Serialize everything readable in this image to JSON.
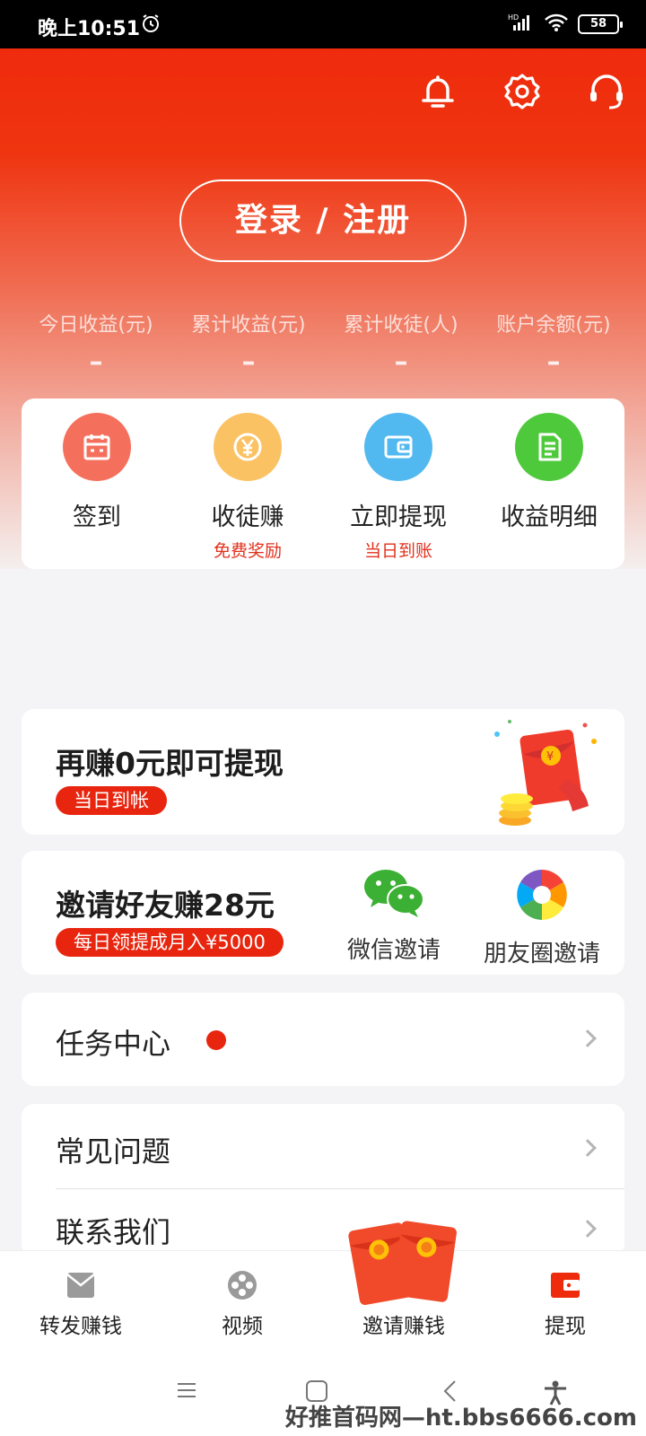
{
  "status_bar": {
    "time": "晚上10:51",
    "battery": "58",
    "network": "HD"
  },
  "header": {
    "login_button": "登录 / 注册",
    "stats": [
      {
        "label": "今日收益(元)",
        "value": "–"
      },
      {
        "label": "累计收益(元)",
        "value": "–"
      },
      {
        "label": "累计收徒(人)",
        "value": "–"
      },
      {
        "label": "账户余额(元)",
        "value": "–"
      }
    ]
  },
  "quick_actions": [
    {
      "label": "签到",
      "sub": "",
      "icon": "calendar-icon",
      "color": "#f5705c"
    },
    {
      "label": "收徒赚",
      "sub": "免费奖励",
      "icon": "yen-coin-icon",
      "color": "#fbc263"
    },
    {
      "label": "立即提现",
      "sub": "当日到账",
      "icon": "wallet-icon",
      "color": "#52b8f0"
    },
    {
      "label": "收益明细",
      "sub": "",
      "icon": "document-icon",
      "color": "#4fc93c"
    }
  ],
  "withdraw_card": {
    "title": "再赚0元即可提现",
    "badge": "当日到帐"
  },
  "invite_card": {
    "title": "邀请好友赚28元",
    "badge": "每日领提成月入¥5000",
    "options": [
      {
        "label": "微信邀请",
        "icon": "wechat-icon"
      },
      {
        "label": "朋友圈邀请",
        "icon": "moments-icon"
      }
    ]
  },
  "menu": {
    "task_center": "任务中心",
    "faq": "常见问题",
    "contact": "联系我们"
  },
  "tabbar": [
    {
      "label": "转发赚钱",
      "icon": "envelope-icon"
    },
    {
      "label": "视频",
      "icon": "film-reel-icon"
    },
    {
      "label": "邀请赚钱",
      "icon": "red-packet-icon"
    },
    {
      "label": "提现",
      "icon": "wallet-icon"
    }
  ],
  "watermark": "好推首码网—ht.bbs6666.com",
  "colors": {
    "brand_red": "#ef2b0d",
    "badge_red": "#e8260f"
  }
}
